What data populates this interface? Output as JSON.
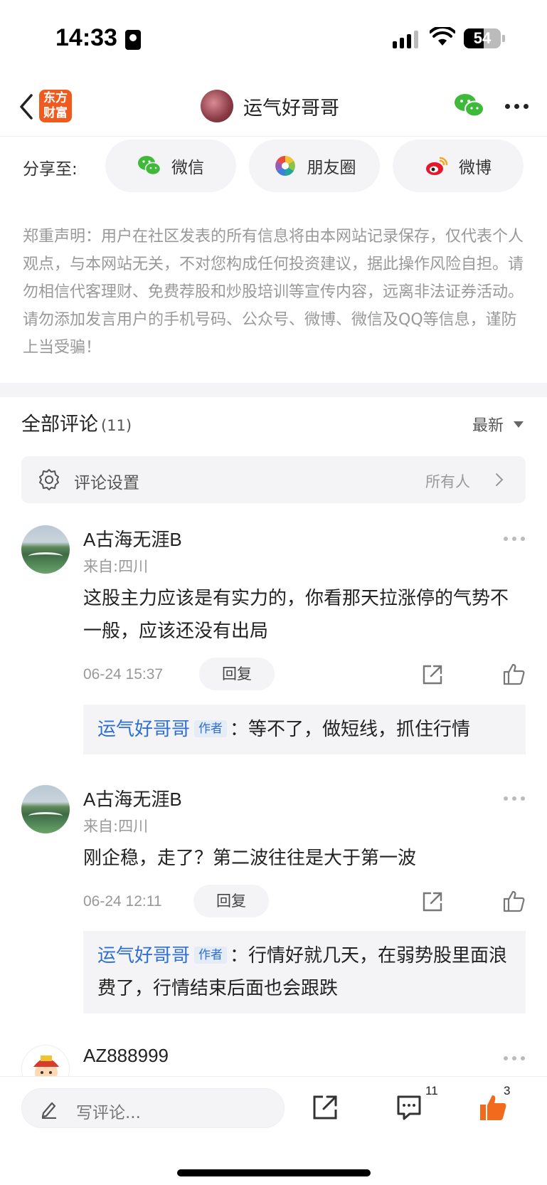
{
  "status_bar": {
    "time": "14:33",
    "battery": "54"
  },
  "nav": {
    "logo_line1": "东方",
    "logo_line2": "财富",
    "title": "运气好哥哥"
  },
  "share": {
    "label": "分享至:",
    "options": [
      {
        "label": "微信",
        "icon": "wechat-icon"
      },
      {
        "label": "朋友圈",
        "icon": "moments-icon"
      },
      {
        "label": "微博",
        "icon": "weibo-icon"
      }
    ]
  },
  "disclaimer": "郑重声明：用户在社区发表的所有信息将由本网站记录保存，仅代表个人观点，与本网站无关，不对您构成任何投资建议，据此操作风险自担。请勿相信代客理财、免费荐股和炒股培训等宣传内容，远离非法证券活动。请勿添加发言用户的手机号码、公众号、微博、微信及QQ等信息，谨防上当受骗！",
  "comments_header": {
    "title": "全部评论",
    "count": "(11)",
    "sort": "最新"
  },
  "comment_settings": {
    "label": "评论设置",
    "value": "所有人"
  },
  "comments": [
    {
      "name": "A古海无涯B",
      "location": "来自:四川",
      "text": "这股主力应该是有实力的，你看那天拉涨停的气势不一般，应该还没有出局",
      "time": "06-24 15:37",
      "reply_label": "回复",
      "reply": {
        "author": "运气好哥哥",
        "tag": "作者",
        "separator": "：",
        "text": "等不了，做短线，抓住行情"
      }
    },
    {
      "name": "A古海无涯B",
      "location": "来自:四川",
      "text": "刚企稳，走了？第二波往往是大于第一波",
      "time": "06-24 12:11",
      "reply_label": "回复",
      "reply": {
        "author": "运气好哥哥",
        "tag": "作者",
        "separator": "：",
        "text": "行情好就几天，在弱势股里面浪费了，行情结束后面也会跟跌"
      }
    },
    {
      "name": "AZ888999"
    }
  ],
  "bottom_bar": {
    "placeholder": "写评论...",
    "comment_count": "11",
    "like_count": "3"
  },
  "colors": {
    "brand": "#ef5a1f",
    "link": "#2e6fd1",
    "like": "#f26b1d",
    "wechat": "#3fb93a"
  }
}
